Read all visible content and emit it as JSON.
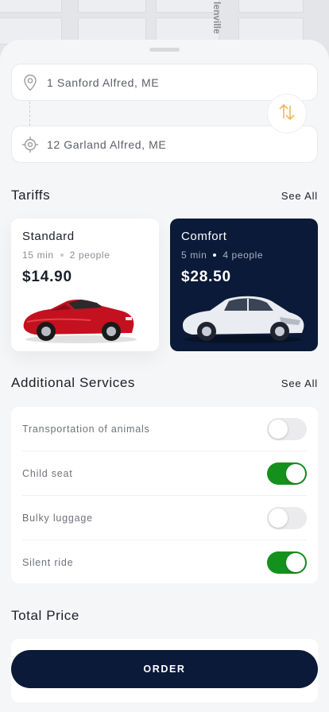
{
  "map": {
    "street_label": "lenville"
  },
  "route": {
    "from": "1 Sanford Alfred, ME",
    "to": "12 Garland Alfred, ME"
  },
  "tariffs": {
    "title": "Tariffs",
    "see_all": "See All",
    "items": [
      {
        "name": "Standard",
        "duration": "15 min",
        "people": "2 people",
        "price": "$14.90",
        "selected": false
      },
      {
        "name": "Comfort",
        "duration": "5 min",
        "people": "4 people",
        "price": "$28.50",
        "selected": true
      }
    ]
  },
  "services": {
    "title": "Additional Services",
    "see_all": "See All",
    "items": [
      {
        "label": "Transportation of animals",
        "enabled": false
      },
      {
        "label": "Child seat",
        "enabled": true
      },
      {
        "label": "Bulky luggage",
        "enabled": false
      },
      {
        "label": "Silent ride",
        "enabled": true
      }
    ]
  },
  "total": {
    "title": "Total Price"
  },
  "order_button": "ORDER",
  "colors": {
    "navy": "#0b1a38",
    "toggle_on": "#14911c",
    "swap_icon": "#f2b84b"
  },
  "icons": {
    "from": "location-pin-icon",
    "to": "target-icon",
    "swap": "swap-arrows-icon"
  }
}
